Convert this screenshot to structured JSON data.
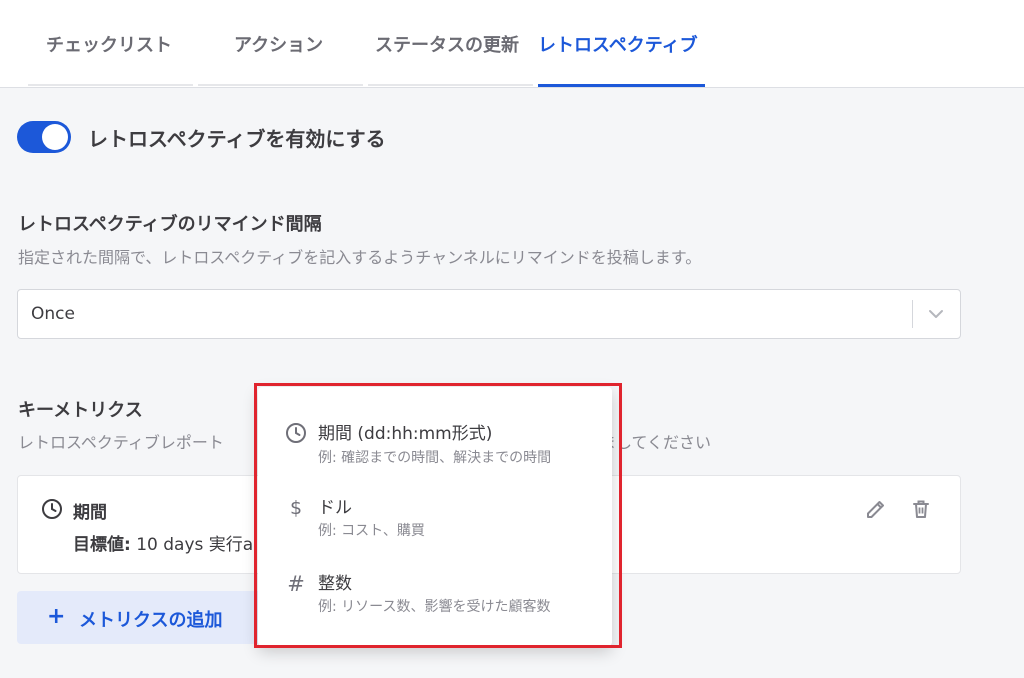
{
  "tabs": [
    {
      "label": "チェックリスト"
    },
    {
      "label": "アクション"
    },
    {
      "label": "ステータスの更新"
    },
    {
      "label": "レトロスペクティブ",
      "active": true
    }
  ],
  "retro_toggle": {
    "label": "レトロスペクティブを有効にする",
    "enabled": true
  },
  "reminder": {
    "title": "レトロスペクティブのリマインド間隔",
    "description": "指定された間隔で、レトロスペクティブを記入するようチャンネルにリマインドを投稿します。",
    "select_value": "Once"
  },
  "key_metrics": {
    "title": "キーメトリクス",
    "description_left": "レトロスペクティブレポート",
    "description_right": "ましてください",
    "card": {
      "name": "期間",
      "target_label": "目標値:",
      "target_value": "10 days 実行a"
    },
    "add_button": "メトリクスの追加"
  },
  "dropdown": {
    "items": [
      {
        "icon": "clock-icon",
        "title": "期間 (dd:hh:mm形式)",
        "desc": "例: 確認までの時間、解決までの時間"
      },
      {
        "icon": "dollar-icon",
        "title": "ドル",
        "desc": "例: コスト、購買"
      },
      {
        "icon": "hash-icon",
        "title": "整数",
        "desc": "例: リソース数、影響を受けた顧客数"
      }
    ]
  },
  "colors": {
    "accent": "#1c58d9",
    "highlight": "#e0242e",
    "background": "#f5f6f8"
  }
}
